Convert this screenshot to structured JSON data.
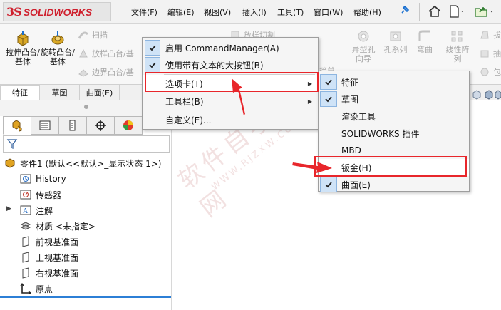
{
  "app": {
    "logo_text": "SOLIDWORKS",
    "logo_mark": "3S"
  },
  "menubar": {
    "items": [
      {
        "label": "文件(F)"
      },
      {
        "label": "编辑(E)"
      },
      {
        "label": "视图(V)"
      },
      {
        "label": "插入(I)"
      },
      {
        "label": "工具(T)"
      },
      {
        "label": "窗口(W)"
      },
      {
        "label": "帮助(H)"
      }
    ]
  },
  "command_manager": {
    "extrude_boss": "拉伸凸台/基体",
    "revolve_boss": "旋转凸台/基体",
    "sweep": "扫描",
    "loft": "放样凸台/基",
    "boundary": "边界凸台/基",
    "loft_cut": "放样切割",
    "hole_wizard_simple": "简单直孔",
    "hole_wizard": "异型孔向导",
    "hole_series": "孔系列",
    "bend": "弯曲",
    "linear_pattern": "线性阵列",
    "draft": "拔",
    "extract": "抽",
    "wrap": "包"
  },
  "tabs": [
    {
      "label": "特征",
      "active": true
    },
    {
      "label": "草图",
      "active": false
    },
    {
      "label": "曲面(E)",
      "active": false
    }
  ],
  "feature_tree": {
    "root": "零件1  (默认<<默认>_显示状态 1>)",
    "items": [
      {
        "label": "History",
        "icon": "history-icon"
      },
      {
        "label": "传感器",
        "icon": "sensor-icon"
      },
      {
        "label": "注解",
        "icon": "annotation-icon",
        "expandable": true
      },
      {
        "label": "材质 <未指定>",
        "icon": "material-icon"
      },
      {
        "label": "前视基准面",
        "icon": "plane-icon"
      },
      {
        "label": "上视基准面",
        "icon": "plane-icon"
      },
      {
        "label": "右视基准面",
        "icon": "plane-icon"
      },
      {
        "label": "原点",
        "icon": "origin-icon"
      }
    ]
  },
  "context_menu": {
    "items": [
      {
        "label": "启用 CommandManager(A)",
        "checked": true
      },
      {
        "label": "使用带有文本的大按钮(B)",
        "checked": true
      },
      {
        "label": "选项卡(T)",
        "checked": false,
        "submenu": true,
        "highlighted": true
      },
      {
        "label": "工具栏(B)",
        "checked": false,
        "submenu": true
      },
      {
        "label": "自定义(E)...",
        "checked": false
      }
    ]
  },
  "submenu": {
    "items": [
      {
        "label": "特征",
        "checked": true
      },
      {
        "label": "草图",
        "checked": true
      },
      {
        "label": "渲染工具",
        "checked": false
      },
      {
        "label": "SOLIDWORKS 插件",
        "checked": false
      },
      {
        "label": "MBD",
        "checked": false
      },
      {
        "label": "钣金(H)",
        "checked": false,
        "highlighted": true
      },
      {
        "label": "曲面(E)",
        "checked": true
      }
    ]
  },
  "watermark": {
    "line1": "软件自学网",
    "line2": "WWW.RJZXW.COM"
  },
  "colors": {
    "accent_red": "#e8262b",
    "brand_red": "#cf1f2d",
    "check_bg": "#cfe3f7",
    "selection_blue": "#2c7fd6"
  }
}
